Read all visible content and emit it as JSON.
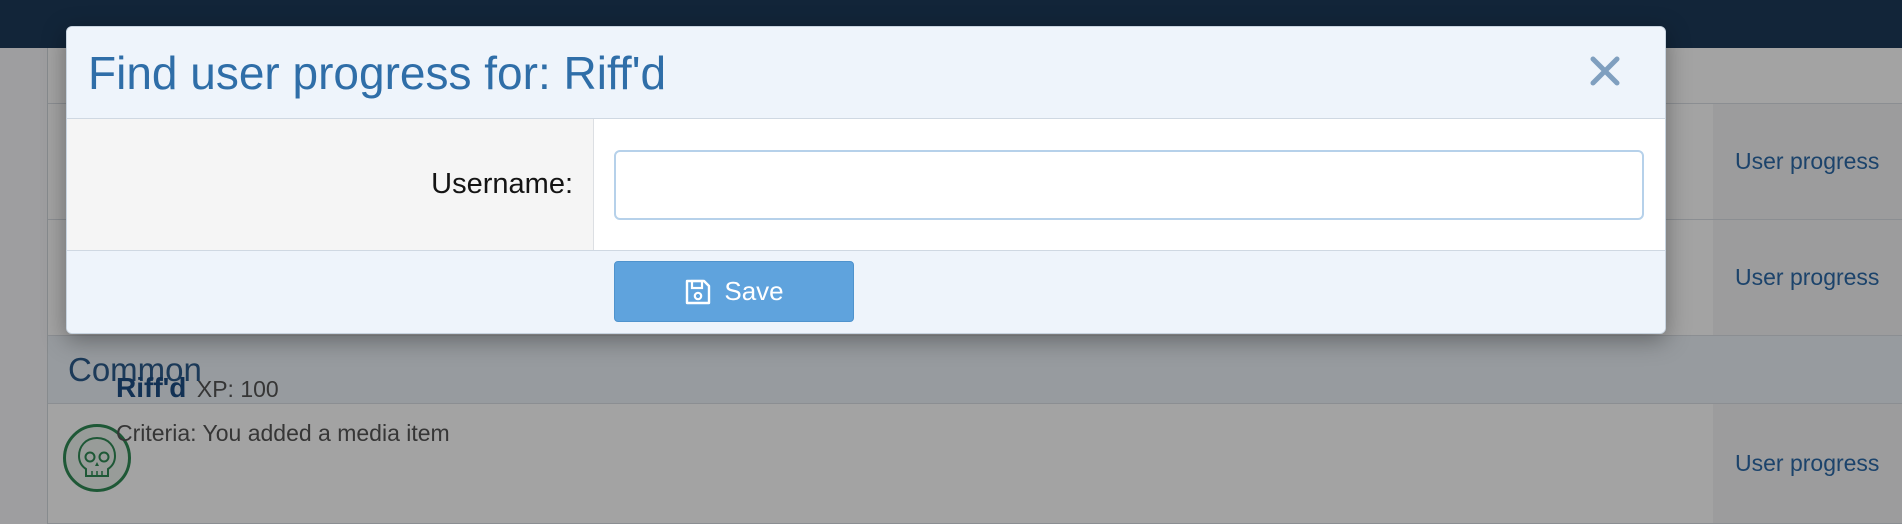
{
  "background": {
    "rows": [
      {
        "action_link": "User progress"
      },
      {
        "action_link": "User progress"
      }
    ],
    "section": {
      "title": "Common"
    },
    "trophy": {
      "name": "Riff'd",
      "xp": "XP: 100",
      "criteria": "Criteria: You added a media item",
      "action_link": "User progress",
      "avatar_icon": "skull-icon"
    }
  },
  "modal": {
    "title": "Find user progress for: Riff'd",
    "close_icon": "close-icon",
    "username_label": "Username:",
    "username_value": "",
    "username_placeholder": "",
    "save_label": "Save",
    "save_icon": "floppy-disk-icon"
  },
  "colors": {
    "topbar": "#1d3a5a",
    "modal_title": "#2f6ea8",
    "save_button": "#5fa3dd",
    "link": "#2c6aa8",
    "avatar_border": "#2f8a55"
  }
}
